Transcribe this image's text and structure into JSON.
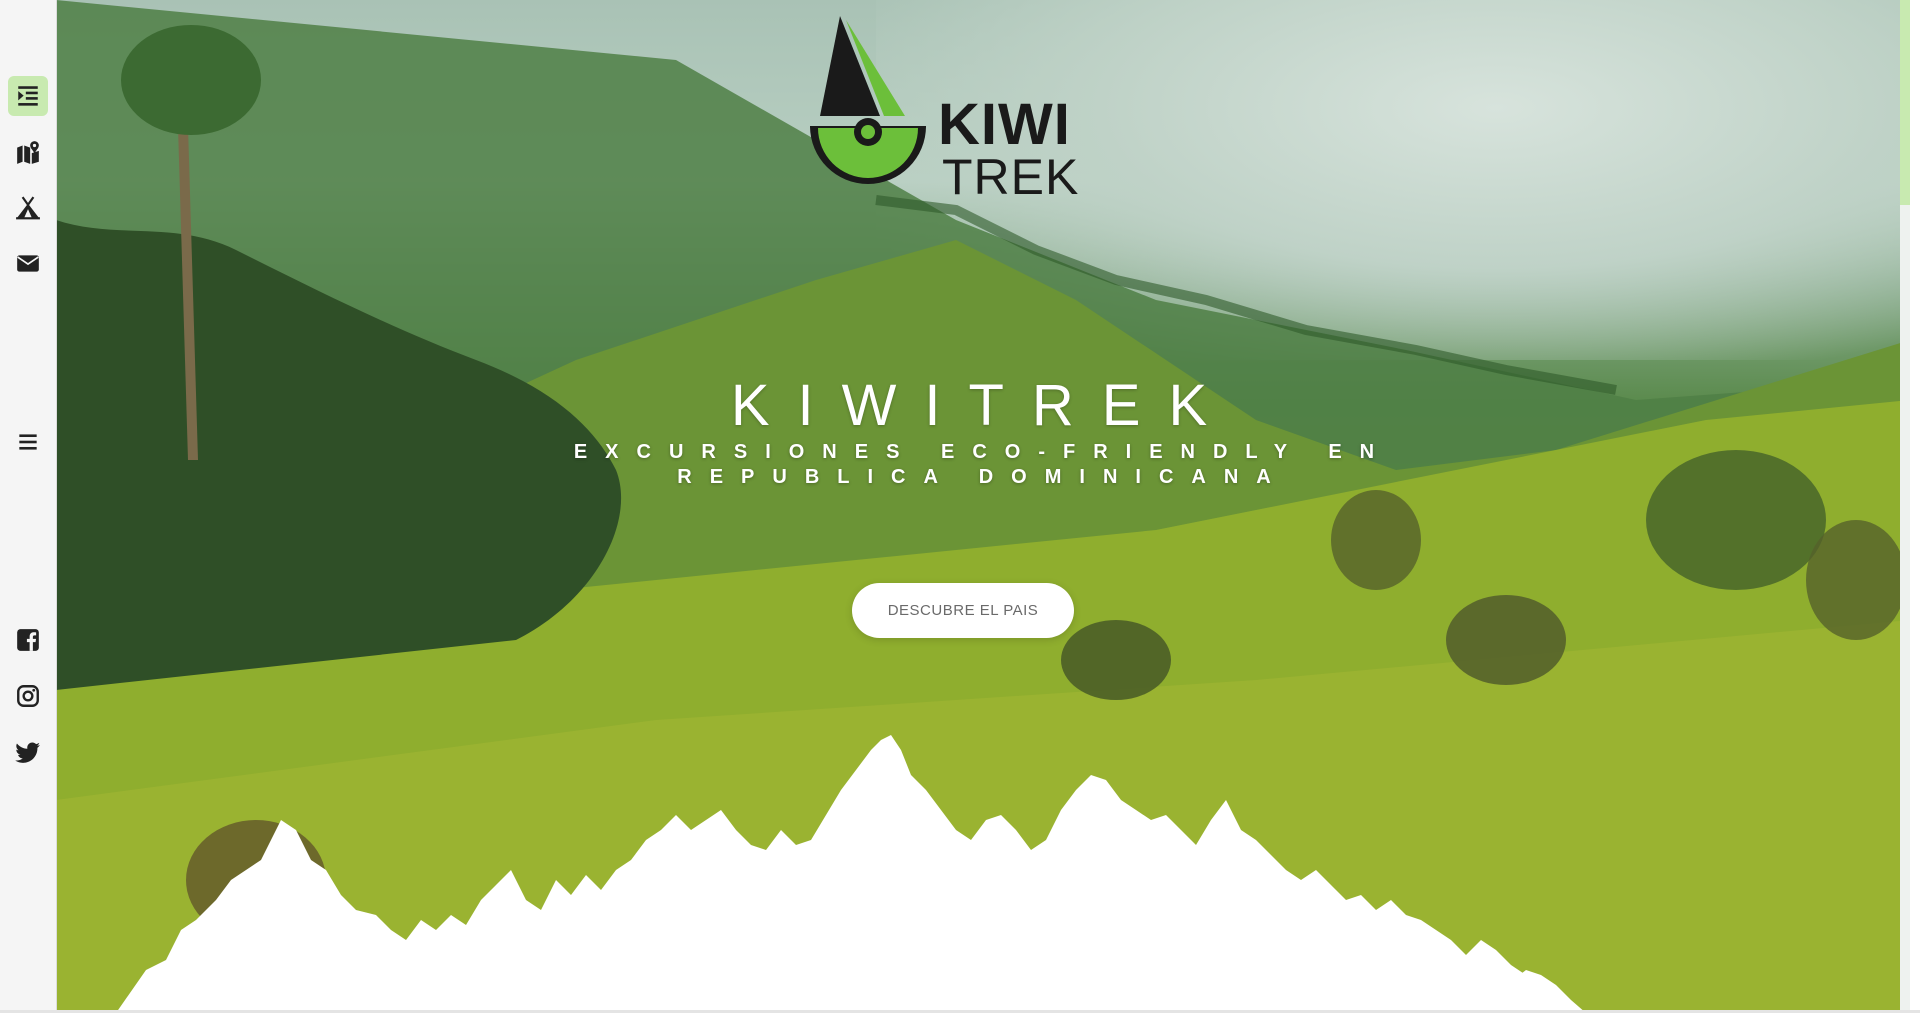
{
  "brand": {
    "logo_line1": "KIWI",
    "logo_line2": "TREK",
    "logo_colors": {
      "green": "#6cbf3a",
      "dark": "#1a1a1a"
    }
  },
  "hero": {
    "title": "KIWITREK",
    "subtitle_line1": "EXCURSIONES ECO-FRIENDLY EN",
    "subtitle_line2": "REPUBLICA DOMINICANA",
    "cta_label": "DESCUBRE EL PAIS"
  },
  "sidebar": {
    "nav": [
      {
        "icon": "indent-icon",
        "active": true
      },
      {
        "icon": "map-marker-icon",
        "active": false
      },
      {
        "icon": "tent-icon",
        "active": false
      },
      {
        "icon": "envelope-icon",
        "active": false
      }
    ],
    "menu_icon": "hamburger-menu-icon",
    "social": [
      {
        "icon": "facebook-icon"
      },
      {
        "icon": "instagram-icon"
      },
      {
        "icon": "twitter-icon"
      }
    ]
  },
  "colors": {
    "accent": "#c8eab0",
    "sidebar_bg": "#f5f5f5"
  }
}
